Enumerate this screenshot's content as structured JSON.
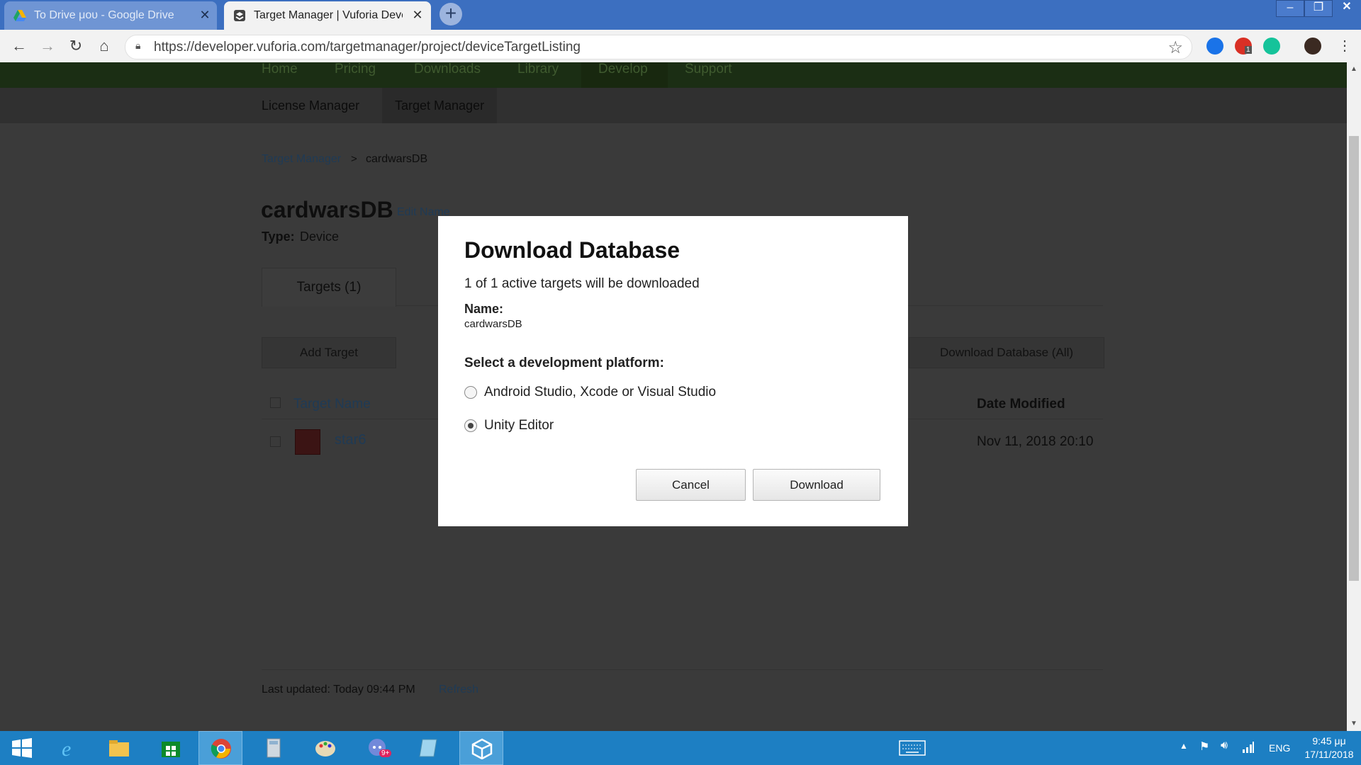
{
  "browser": {
    "tabs": [
      {
        "title": "To Drive μου - Google Drive",
        "close": "✕"
      },
      {
        "title": "Target Manager | Vuforia Develop",
        "close": "✕"
      }
    ],
    "new_tab": "+",
    "window_controls": {
      "minimize": "–",
      "restore": "❐",
      "close": "✕"
    },
    "url_display": "https://developer.vuforia.com/targetmanager/project/deviceTargetListing",
    "extensions": [
      {
        "icon": "mail-extension-icon",
        "color": "#1a73e8"
      },
      {
        "icon": "adblock-icon",
        "color": "#d93025",
        "badge": "1"
      },
      {
        "icon": "grammarly-icon",
        "color": "#15c39a"
      },
      {
        "icon": "profile-avatar-icon",
        "color": "#3b2a22"
      }
    ]
  },
  "site": {
    "top_nav": [
      "Home",
      "Pricing",
      "Downloads",
      "Library",
      "Develop",
      "Support"
    ],
    "sub_nav": [
      "License Manager",
      "Target Manager"
    ],
    "breadcrumb": {
      "link": "Target Manager",
      "separator": ">",
      "current": "cardwarsDB"
    },
    "database": {
      "name": "cardwarsDB",
      "edit_link": "Edit Name",
      "type_label": "Type:",
      "type_value": "Device"
    },
    "tabs": [
      "Targets (1)"
    ],
    "buttons": {
      "add_target": "Add Target",
      "download_all": "Download Database (All)"
    },
    "table": {
      "columns": {
        "target_name": "Target Name",
        "date_modified": "Date Modified"
      },
      "rows": [
        {
          "name": "star6",
          "date": "Nov 11, 2018 20:10"
        }
      ]
    },
    "footer": {
      "last_updated": "Last updated: Today 09:44 PM",
      "refresh": "Refresh"
    }
  },
  "modal": {
    "title": "Download Database",
    "info": "1 of 1 active targets will be downloaded",
    "name_label": "Name:",
    "name_value": "cardwarsDB",
    "platform_label": "Select a development platform:",
    "options": [
      {
        "label": "Android Studio, Xcode or Visual Studio",
        "selected": false
      },
      {
        "label": "Unity Editor",
        "selected": true
      }
    ],
    "cancel": "Cancel",
    "download": "Download"
  },
  "taskbar": {
    "apps": [
      "start-button",
      "internet-explorer",
      "file-explorer",
      "store",
      "chrome",
      "calculator",
      "paint",
      "discord",
      "notepad",
      "unity"
    ],
    "discord_badge": "9+",
    "tray": {
      "lang": "ENG",
      "time": "9:45 μμ",
      "date": "17/11/2018"
    }
  }
}
